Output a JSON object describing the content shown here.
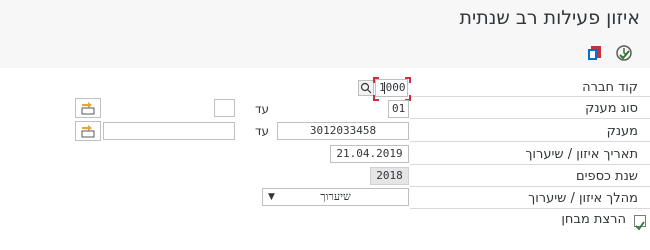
{
  "app": {
    "title": "איזון פעילות רב שנתית"
  },
  "toolbar": {
    "execute_icon": "execute-clock-icon",
    "variant_icon": "variant-copy-icon"
  },
  "form": {
    "company_code": {
      "label": "קוד חברה",
      "value": "1000"
    },
    "beneficiary_type": {
      "label": "סוג מענק",
      "value": "01",
      "to_label": "עד",
      "to_value": ""
    },
    "beneficiary": {
      "label": "מענק",
      "value": "3012033458",
      "to_label": "עד",
      "to_value": ""
    },
    "balance_date": {
      "label": "תאריך איזון / שיערוך",
      "value": "21.04.2019"
    },
    "fiscal_year": {
      "label": "שנת כספים",
      "value": "2018"
    },
    "process": {
      "label": "מהלך איזון / שיערוך",
      "value": "שיערוך"
    },
    "test_run": {
      "label": "הרצת מבחן",
      "checked": true
    }
  },
  "colors": {
    "accent": "#0a6ed1",
    "focus": "#c7303c",
    "check": "#2b7c2b",
    "bg": "#f7f7f7"
  }
}
